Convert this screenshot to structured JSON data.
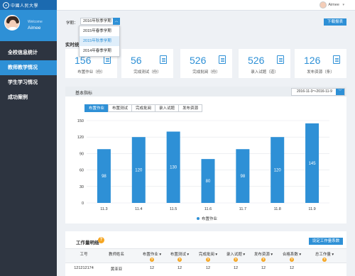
{
  "sidebar": {
    "logo_text": "中國人民大學",
    "welcome": "Welcome",
    "username": "Aimee",
    "items": [
      {
        "label": "全校信息统计",
        "active": false
      },
      {
        "label": "教师教学情况",
        "active": true
      },
      {
        "label": "学生学习情况",
        "active": false
      },
      {
        "label": "成功案例",
        "active": false
      }
    ]
  },
  "topbar": {
    "username": "Aimee"
  },
  "term": {
    "label": "学期：",
    "selected": "2016年秋季学期",
    "options": [
      {
        "label": "2015年春季学期",
        "selected": false
      },
      {
        "label": "2015年秋季学期",
        "selected": true
      },
      {
        "label": "2014年春季学期",
        "selected": false
      }
    ]
  },
  "download_label": "下载报表",
  "realtime_title": "实时统",
  "stats": [
    {
      "value": "156",
      "label": "布置作业（份）",
      "icon": "document-icon"
    },
    {
      "value": "56",
      "label": "完成测试（份）",
      "icon": "edit-icon"
    },
    {
      "value": "526",
      "label": "完成批阅（份）",
      "icon": "list-icon"
    },
    {
      "value": "526",
      "label": "录入试题（道）",
      "icon": "form-icon"
    },
    {
      "value": "126",
      "label": "发布资源（条）",
      "icon": "publish-icon"
    }
  ],
  "basic": {
    "title": "基本指标",
    "date_range": "2016-11-3～2016-11-9",
    "tabs": [
      "布置作业",
      "布置测试",
      "完成批阅",
      "录入试题",
      "发布资源"
    ]
  },
  "chart_data": {
    "type": "bar",
    "categories": [
      "11.3",
      "11.4",
      "11.5",
      "11.6",
      "11.7",
      "11.8",
      "11.9"
    ],
    "series": [
      {
        "name": "布置作业",
        "values": [
          98,
          120,
          130,
          80,
          98,
          120,
          145
        ]
      }
    ],
    "ylim": [
      0,
      150
    ],
    "yticks": [
      0,
      30,
      60,
      90,
      120,
      150
    ],
    "grid": true,
    "legend": "bottom-center",
    "bar_color": "#2e90d6"
  },
  "work": {
    "title": "工作量明细",
    "set_button": "设定工作量系数",
    "columns": [
      {
        "label": "工号",
        "help": false
      },
      {
        "label": "教师姓名",
        "help": false
      },
      {
        "label": "布置作业",
        "help": true
      },
      {
        "label": "布置测试",
        "help": true
      },
      {
        "label": "完成批阅",
        "help": true
      },
      {
        "label": "录入试题",
        "help": true
      },
      {
        "label": "发布资源",
        "help": true
      },
      {
        "label": "合格系数",
        "help": true
      },
      {
        "label": "总工作量",
        "help": true
      }
    ],
    "rows": [
      [
        "121212174",
        "黄亚亚",
        "12",
        "12",
        "12",
        "12",
        "12",
        "12",
        ""
      ]
    ]
  }
}
